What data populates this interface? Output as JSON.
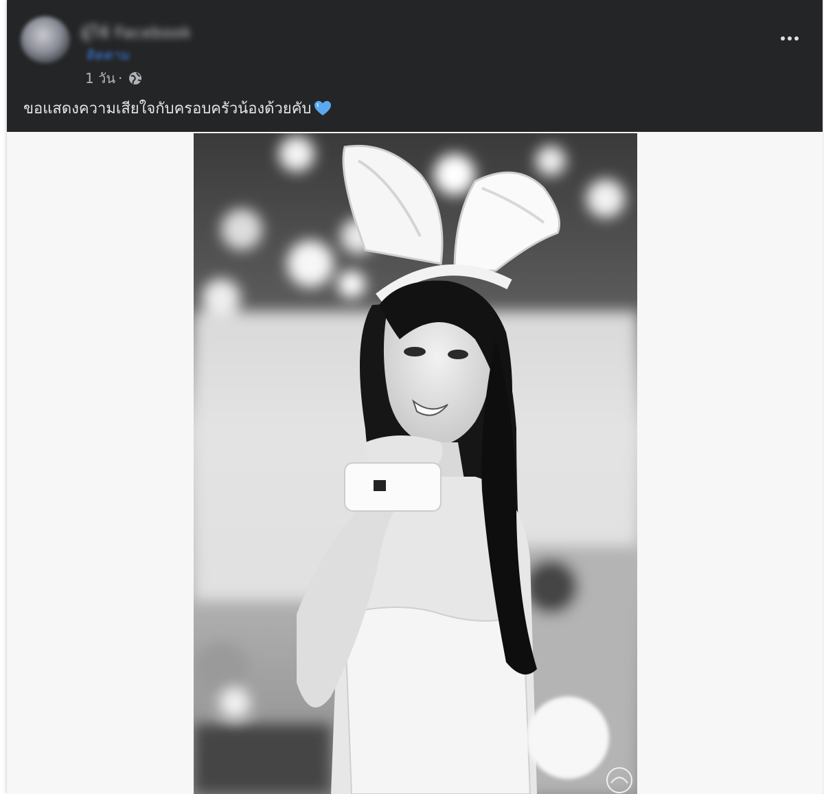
{
  "post": {
    "author_name": "ผู้ใช้ Facebook",
    "follow_label": "ติดตาม",
    "time": "1 วัน",
    "separator": "·",
    "audience_icon": "globe-icon",
    "more_icon": "more-options-icon",
    "text": "ขอแสดงความเสียใจกับครอบครัวน้องด้วยคับ",
    "emoji_icon": "blue-heart-icon",
    "emoji_color": "#5aa9f0"
  },
  "photo": {
    "description_icon": "bunny-costume-photo",
    "watermark_icon": "watermark-logo-icon"
  },
  "colors": {
    "header_bg": "#242526",
    "text_primary": "#e4e6eb",
    "text_secondary": "#b0b3b8",
    "link": "#3b7bd9"
  }
}
